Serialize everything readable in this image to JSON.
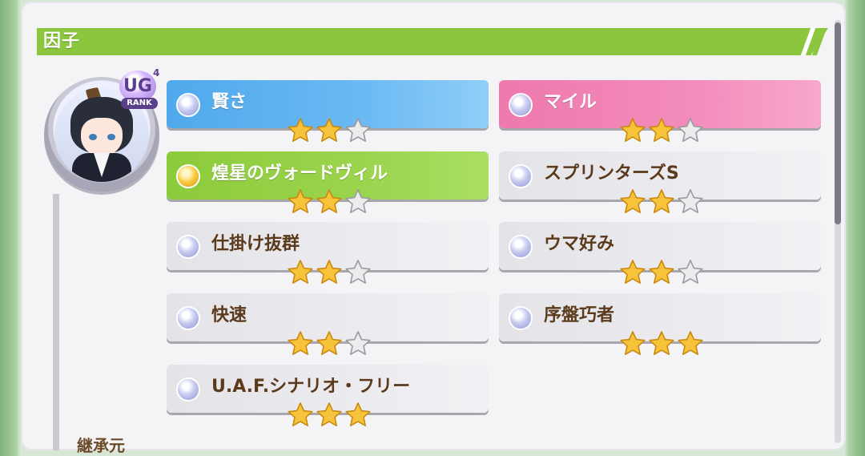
{
  "section": {
    "title": "因子"
  },
  "rank_badge": {
    "letters": "UG",
    "superscript": "4",
    "label": "RANK"
  },
  "footer_partial_text": "継承元",
  "factors": [
    {
      "name": "賢さ",
      "stars": 2,
      "max_stars": 3,
      "type": "blue",
      "orb": "silver"
    },
    {
      "name": "マイル",
      "stars": 2,
      "max_stars": 3,
      "type": "pink",
      "orb": "silver"
    },
    {
      "name": "煌星のヴォードヴィル",
      "stars": 2,
      "max_stars": 3,
      "type": "green",
      "orb": "gold"
    },
    {
      "name": "スプリンターズS",
      "stars": 2,
      "max_stars": 3,
      "type": "gray",
      "orb": "silver"
    },
    {
      "name": "仕掛け抜群",
      "stars": 2,
      "max_stars": 3,
      "type": "gray",
      "orb": "silver"
    },
    {
      "name": "ウマ好み",
      "stars": 2,
      "max_stars": 3,
      "type": "gray",
      "orb": "silver"
    },
    {
      "name": "快速",
      "stars": 2,
      "max_stars": 3,
      "type": "gray",
      "orb": "silver"
    },
    {
      "name": "序盤巧者",
      "stars": 3,
      "max_stars": 3,
      "type": "gray",
      "orb": "silver"
    },
    {
      "name": "U.A.F.シナリオ・フリー",
      "stars": 3,
      "max_stars": 3,
      "type": "gray",
      "orb": "silver"
    }
  ],
  "colors": {
    "header_green": "#8cc63f",
    "blue_factor": "#4fa9ec",
    "pink_factor": "#ee79ad",
    "green_factor": "#8ccb3b",
    "star_gold": "#f6c33a",
    "star_empty": "#ececec",
    "text_brown": "#5b3a1c"
  }
}
